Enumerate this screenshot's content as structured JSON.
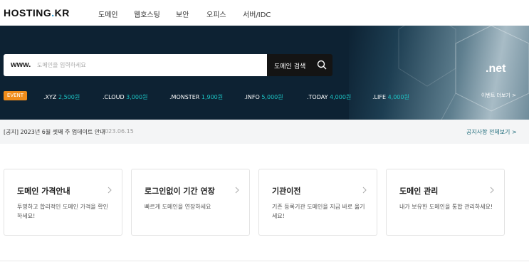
{
  "header": {
    "logo_main": "HOSTING",
    "logo_dot": ".",
    "logo_suffix": "KR",
    "nav": [
      "도메인",
      "웹호스팅",
      "보안",
      "오피스",
      "서버/IDC"
    ]
  },
  "hero": {
    "search": {
      "prefix": "www.",
      "placeholder": "도메인을 입력하세요",
      "value": "",
      "button_label": "도메인 검색"
    },
    "event_badge": "EVENT",
    "tlds": [
      {
        "name": ".XYZ",
        "price": "2,500원"
      },
      {
        "name": ".CLOUD",
        "price": "3,000원"
      },
      {
        "name": ".MONSTER",
        "price": "1,900원"
      },
      {
        "name": ".INFO",
        "price": "5,000원"
      },
      {
        "name": ".TODAY",
        "price": "4,000원"
      },
      {
        "name": ".LIFE",
        "price": "4,000원"
      }
    ],
    "promo_tld": ".net",
    "event_more": "이벤트 더보기 >"
  },
  "notice": {
    "text": "[공지] 2023년 6월 셋째 주 업데이트 안내",
    "date": "2023.06.15",
    "view_all": "공지사항 전체보기 >"
  },
  "cards": [
    {
      "title": "도메인 가격안내",
      "desc": "투명하고 합리적인 도메인 가격을 확인하세요!"
    },
    {
      "title": "로그인없이 기간 연장",
      "desc": "빠르게 도메인을 연장하세요"
    },
    {
      "title": "기관이전",
      "desc": "기존 등록기관 도메인을 지금 바로 옮기세요!"
    },
    {
      "title": "도메인 관리",
      "desc": "내가 보유한 도메인을 통합 관리하세요!"
    }
  ],
  "colors": {
    "hero_bg": "#0d2233",
    "event_orange": "#f08c1a",
    "price_teal": "#1cc6c6",
    "logo_accent": "#1b9ad8"
  }
}
